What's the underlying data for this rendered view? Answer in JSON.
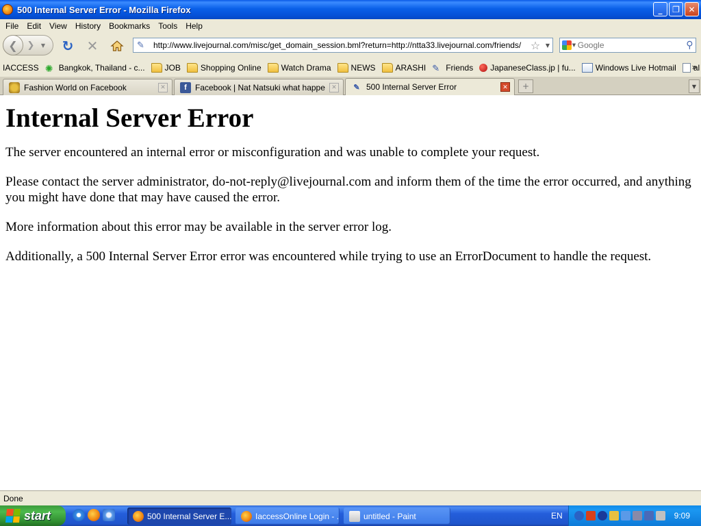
{
  "window": {
    "title": "500 Internal Server Error - Mozilla Firefox",
    "controls": {
      "minimize": "_",
      "maximize": "❐",
      "close": "✕"
    }
  },
  "menu": [
    "File",
    "Edit",
    "View",
    "History",
    "Bookmarks",
    "Tools",
    "Help"
  ],
  "navigation": {
    "url": "http://www.livejournal.com/misc/get_domain_session.bml?return=http://ntta33.livejournal.com/friends/",
    "search_placeholder": "Google"
  },
  "bookmarks": [
    {
      "label": "IACCESS",
      "icon": "none"
    },
    {
      "label": "Bangkok, Thailand - c...",
      "icon": "weather-sun-icon"
    },
    {
      "label": "JOB",
      "icon": "folder-icon"
    },
    {
      "label": "Shopping Online",
      "icon": "folder-icon"
    },
    {
      "label": "Watch Drama",
      "icon": "folder-icon"
    },
    {
      "label": "NEWS",
      "icon": "folder-icon"
    },
    {
      "label": "ARASHI",
      "icon": "folder-icon"
    },
    {
      "label": "Friends",
      "icon": "livejournal-pencil-icon"
    },
    {
      "label": "JapaneseClass.jp | fu...",
      "icon": "red-dot-icon"
    },
    {
      "label": "Windows Live Hotmail",
      "icon": "hotmail-icon"
    },
    {
      "label": "al fine",
      "icon": "page-icon"
    }
  ],
  "bookmarks_more": "»",
  "tabs": [
    {
      "label": "Fashion World on Facebook",
      "active": false
    },
    {
      "label": "Facebook | Nat Natsuki what happen w...",
      "active": false
    },
    {
      "label": "500 Internal Server Error",
      "active": true
    }
  ],
  "page": {
    "heading": "Internal Server Error",
    "paragraphs": [
      "The server encountered an internal error or misconfiguration and was unable to complete your request.",
      "Please contact the server administrator, do-not-reply@livejournal.com and inform them of the time the error occurred, and anything you might have done that may have caused the error.",
      "More information about this error may be available in the server error log.",
      "Additionally, a 500 Internal Server Error error was encountered while trying to use an ErrorDocument to handle the request."
    ]
  },
  "status": "Done",
  "taskbar": {
    "start_label": "start",
    "tasks": [
      {
        "label": "500 Internal Server E...",
        "active": true
      },
      {
        "label": "IaccessOnline Login - ...",
        "active": false
      },
      {
        "label": "untitled - Paint",
        "active": false
      }
    ],
    "language": "EN",
    "clock": "9:09"
  },
  "colors": {
    "title_bar": "#0a5ae6",
    "chrome": "#ece9d8",
    "taskbar": "#245edb",
    "start_button": "#3c9b3c",
    "tray": "#0f8ae8"
  }
}
